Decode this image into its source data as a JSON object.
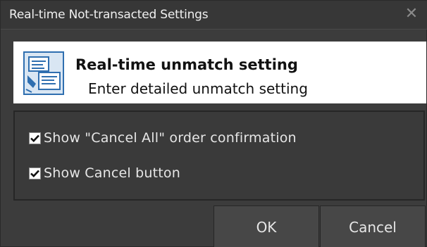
{
  "window": {
    "title": "Real-time Not-transacted Settings",
    "close_glyph": "✕"
  },
  "header": {
    "icon": "settings-document-icon",
    "title": "Real-time unmatch setting",
    "subtitle": "Enter detailed unmatch setting"
  },
  "options": [
    {
      "label": "Show \"Cancel All\" order confirmation",
      "checked": true
    },
    {
      "label": "Show Cancel button",
      "checked": true
    }
  ],
  "buttons": {
    "ok_label": "OK",
    "cancel_label": "Cancel"
  },
  "colors": {
    "background": "#3c3c3c",
    "header_background": "#ffffff",
    "text_light": "#e6e6e6",
    "text_dark": "#111111",
    "icon_accent": "#2f6fb0"
  }
}
